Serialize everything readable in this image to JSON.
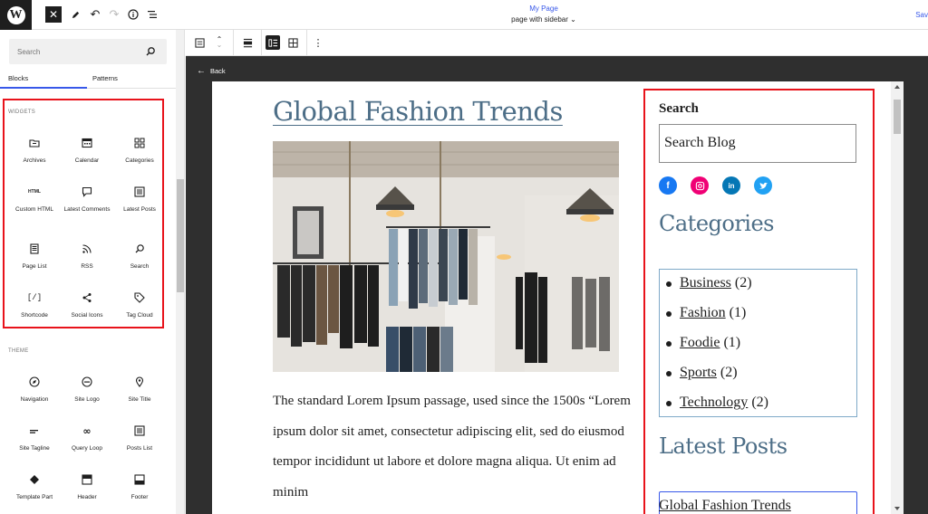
{
  "header": {
    "page_title": "My Page",
    "template": "page with sidebar",
    "save_label": "Sav"
  },
  "inserter": {
    "search_placeholder": "Search",
    "tabs": [
      "Blocks",
      "Patterns"
    ],
    "widgets_title": "WIDGETS",
    "widgets": [
      {
        "label": "Archives",
        "icon": "archives-icon"
      },
      {
        "label": "Calendar",
        "icon": "calendar-icon"
      },
      {
        "label": "Categories",
        "icon": "categories-icon"
      },
      {
        "label": "Custom HTML",
        "icon": "html-icon"
      },
      {
        "label": "Latest Comments",
        "icon": "comments-icon"
      },
      {
        "label": "Latest Posts",
        "icon": "latest-posts-icon"
      },
      {
        "label": "Page List",
        "icon": "page-list-icon"
      },
      {
        "label": "RSS",
        "icon": "rss-icon"
      },
      {
        "label": "Search",
        "icon": "search-icon"
      },
      {
        "label": "Shortcode",
        "icon": "shortcode-icon"
      },
      {
        "label": "Social Icons",
        "icon": "share-icon"
      },
      {
        "label": "Tag Cloud",
        "icon": "tag-icon"
      }
    ],
    "theme_title": "THEME",
    "theme": [
      {
        "label": "Navigation",
        "icon": "navigation-icon"
      },
      {
        "label": "Site Logo",
        "icon": "site-logo-icon"
      },
      {
        "label": "Site Title",
        "icon": "map-marker-icon"
      },
      {
        "label": "Site Tagline",
        "icon": "tagline-icon"
      },
      {
        "label": "Query Loop",
        "icon": "loop-icon"
      },
      {
        "label": "Posts List",
        "icon": "posts-list-icon"
      },
      {
        "label": "Template Part",
        "icon": "template-part-icon"
      },
      {
        "label": "Header",
        "icon": "header-icon"
      },
      {
        "label": "Footer",
        "icon": "footer-icon"
      }
    ]
  },
  "canvas": {
    "back_label": "Back",
    "post_title": "Global Fashion Trends",
    "post_body": "The standard Lorem Ipsum passage, used since the 1500s “Lorem ipsum dolor sit amet, consectetur adipiscing elit, sed do eiusmod tempor incididunt ut labore et dolore magna aliqua. Ut enim ad minim",
    "sidebar": {
      "search_title": "Search",
      "search_value": "Search Blog",
      "social": [
        {
          "icon": "facebook-icon",
          "color": "#1778f2"
        },
        {
          "icon": "instagram-icon",
          "color": "#f00075"
        },
        {
          "icon": "linkedin-icon",
          "color": "#0577b5"
        },
        {
          "icon": "twitter-icon",
          "color": "#21a1f3"
        }
      ],
      "categories_title": "Categories",
      "categories": [
        {
          "name": "Business",
          "count": "(2)"
        },
        {
          "name": "Fashion",
          "count": "(1)"
        },
        {
          "name": "Foodie",
          "count": "(1)"
        },
        {
          "name": "Sports",
          "count": "(2)"
        },
        {
          "name": "Technology",
          "count": "(2)"
        }
      ],
      "latest_title": "Latest Posts",
      "latest_first": "Global Fashion Trends"
    }
  },
  "colors": {
    "accent": "#3858e9",
    "highlight": "#e8131b",
    "heading": "#4d6e87"
  }
}
